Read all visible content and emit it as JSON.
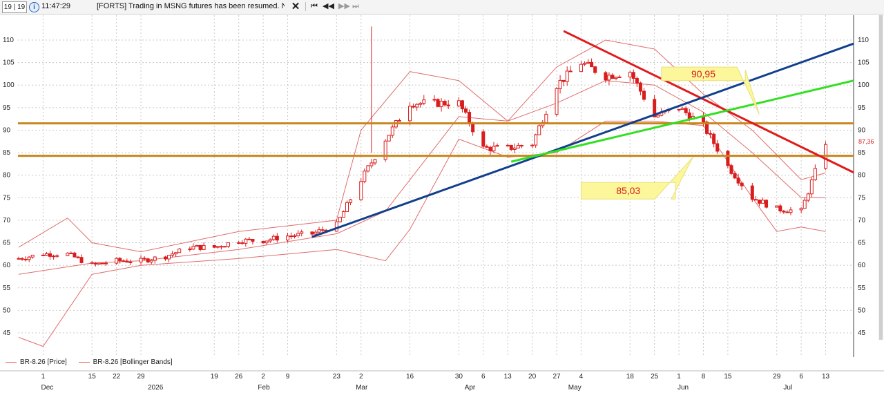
{
  "toolbar": {
    "counter": "19 | 19",
    "time": "11:47:29",
    "message": "[FORTS] Trading in MSNG futures has been resumed. New lower bounds o",
    "close_symbol": "✕",
    "nav_first": "⏮",
    "nav_prev": "◀◀",
    "nav_next": "▶▶",
    "nav_last": "⏭"
  },
  "legend": [
    {
      "label": "BR-8.26 [Price]"
    },
    {
      "label": "BR-8.26 [Bollinger Bands]"
    }
  ],
  "colors": {
    "candle": "#d91c1c",
    "band": "#e06b6b",
    "resistance": "#c9861a",
    "red_trend": "#e01b1b",
    "blue_trend": "#123f8c",
    "green_trend": "#33e020",
    "callout": "#fbf79a",
    "callout_text": "#d91c1c"
  },
  "chart_data": {
    "type": "candlestick",
    "y_axis": {
      "min": 40,
      "max": 112,
      "ticks": [
        45,
        50,
        55,
        60,
        65,
        70,
        75,
        80,
        85,
        90,
        95,
        100,
        105,
        110
      ]
    },
    "last_price_label": "87,36",
    "x_ticks": [
      {
        "label": "1",
        "x": "2025-12-01"
      },
      {
        "label": "15",
        "x": "2025-12-15"
      },
      {
        "label": "22",
        "x": "2025-12-22"
      },
      {
        "label": "29",
        "x": "2025-12-29"
      },
      {
        "label": "19",
        "x": "2026-01-19"
      },
      {
        "label": "26",
        "x": "2026-01-26"
      },
      {
        "label": "2",
        "x": "2026-02-02"
      },
      {
        "label": "9",
        "x": "2026-02-09"
      },
      {
        "label": "23",
        "x": "2026-02-23"
      },
      {
        "label": "2",
        "x": "2026-03-02"
      },
      {
        "label": "16",
        "x": "2026-03-16"
      },
      {
        "label": "30",
        "x": "2026-03-30"
      },
      {
        "label": "6",
        "x": "2026-04-06"
      },
      {
        "label": "13",
        "x": "2026-04-13"
      },
      {
        "label": "20",
        "x": "2026-04-20"
      },
      {
        "label": "27",
        "x": "2026-04-27"
      },
      {
        "label": "4",
        "x": "2026-05-04"
      },
      {
        "label": "18",
        "x": "2026-05-18"
      },
      {
        "label": "25",
        "x": "2026-05-25"
      },
      {
        "label": "1",
        "x": "2026-06-01"
      },
      {
        "label": "8",
        "x": "2026-06-08"
      },
      {
        "label": "15",
        "x": "2026-06-15"
      },
      {
        "label": "29",
        "x": "2026-06-29"
      },
      {
        "label": "6",
        "x": "2026-07-06"
      },
      {
        "label": "13",
        "x": "2026-07-13"
      }
    ],
    "months": [
      {
        "label": "Dec",
        "x": "2025-12-01"
      },
      {
        "label": "2026",
        "x": "2026-01-01"
      },
      {
        "label": "Feb",
        "x": "2026-02-01"
      },
      {
        "label": "Mar",
        "x": "2026-03-01"
      },
      {
        "label": "Apr",
        "x": "2026-04-01"
      },
      {
        "label": "May",
        "x": "2026-05-01"
      },
      {
        "label": "Jun",
        "x": "2026-06-01"
      },
      {
        "label": "Jul",
        "x": "2026-07-01"
      }
    ],
    "price_path": [
      [
        "2025-11-24",
        61.5
      ],
      [
        "2025-12-01",
        62.5
      ],
      [
        "2025-12-08",
        62.5
      ],
      [
        "2025-12-15",
        60.0
      ],
      [
        "2025-12-22",
        61.0
      ],
      [
        "2025-12-29",
        61.0
      ],
      [
        "2026-01-05",
        62.0
      ],
      [
        "2026-01-12",
        64.0
      ],
      [
        "2026-01-19",
        64.0
      ],
      [
        "2026-01-26",
        65.5
      ],
      [
        "2026-02-02",
        65.5
      ],
      [
        "2026-02-09",
        66.5
      ],
      [
        "2026-02-16",
        67.0
      ],
      [
        "2026-02-23",
        69.0
      ],
      [
        "2026-03-02",
        79.0
      ],
      [
        "2026-03-09",
        88.0
      ],
      [
        "2026-03-16",
        96.0
      ],
      [
        "2026-03-23",
        96.0
      ],
      [
        "2026-03-30",
        96.0
      ],
      [
        "2026-04-06",
        86.0
      ],
      [
        "2026-04-13",
        86.0
      ],
      [
        "2026-04-20",
        87.0
      ],
      [
        "2026-04-27",
        100.0
      ],
      [
        "2026-05-04",
        105.0
      ],
      [
        "2026-05-11",
        102.0
      ],
      [
        "2026-05-18",
        103.0
      ],
      [
        "2026-05-25",
        93.0
      ],
      [
        "2026-06-01",
        95.0
      ],
      [
        "2026-06-08",
        91.0
      ],
      [
        "2026-06-15",
        82.0
      ],
      [
        "2026-06-22",
        75.0
      ],
      [
        "2026-06-29",
        72.5
      ],
      [
        "2026-07-06",
        72.0
      ],
      [
        "2026-07-13",
        87.36
      ]
    ],
    "bollinger_upper": [
      [
        "2025-11-24",
        64.0
      ],
      [
        "2025-12-08",
        70.5
      ],
      [
        "2025-12-15",
        65.0
      ],
      [
        "2025-12-29",
        63.0
      ],
      [
        "2026-01-26",
        67.5
      ],
      [
        "2026-02-23",
        70.0
      ],
      [
        "2026-03-02",
        90.0
      ],
      [
        "2026-03-16",
        103.0
      ],
      [
        "2026-03-30",
        101.0
      ],
      [
        "2026-04-13",
        92.0
      ],
      [
        "2026-04-27",
        104.0
      ],
      [
        "2026-05-11",
        110.0
      ],
      [
        "2026-05-25",
        108.0
      ],
      [
        "2026-06-08",
        98.0
      ],
      [
        "2026-06-22",
        90.0
      ],
      [
        "2026-07-06",
        79.0
      ],
      [
        "2026-07-13",
        80.5
      ]
    ],
    "bollinger_middle": [
      [
        "2025-11-24",
        58.0
      ],
      [
        "2025-12-15",
        60.5
      ],
      [
        "2025-12-29",
        61.0
      ],
      [
        "2026-01-26",
        63.5
      ],
      [
        "2026-02-23",
        67.0
      ],
      [
        "2026-03-09",
        72.0
      ],
      [
        "2026-03-30",
        93.0
      ],
      [
        "2026-04-13",
        92.0
      ],
      [
        "2026-04-27",
        96.0
      ],
      [
        "2026-05-11",
        101.0
      ],
      [
        "2026-05-25",
        100.0
      ],
      [
        "2026-06-08",
        94.0
      ],
      [
        "2026-06-22",
        85.0
      ],
      [
        "2026-07-06",
        75.0
      ],
      [
        "2026-07-13",
        75.0
      ]
    ],
    "bollinger_lower": [
      [
        "2025-11-24",
        44.0
      ],
      [
        "2025-12-01",
        42.0
      ],
      [
        "2025-12-15",
        58.0
      ],
      [
        "2025-12-29",
        60.0
      ],
      [
        "2026-01-26",
        61.5
      ],
      [
        "2026-02-23",
        63.5
      ],
      [
        "2026-03-09",
        61.0
      ],
      [
        "2026-03-16",
        68.0
      ],
      [
        "2026-03-30",
        88.0
      ],
      [
        "2026-04-13",
        84.0
      ],
      [
        "2026-04-27",
        85.0
      ],
      [
        "2026-05-11",
        92.0
      ],
      [
        "2026-05-25",
        92.0
      ],
      [
        "2026-06-08",
        91.0
      ],
      [
        "2026-06-22",
        75.0
      ],
      [
        "2026-06-29",
        67.5
      ],
      [
        "2026-07-06",
        68.5
      ],
      [
        "2026-07-13",
        67.5
      ]
    ],
    "horizontal_levels": [
      {
        "value": 91.5
      },
      {
        "value": 84.3
      }
    ],
    "trend_lines": [
      {
        "color_key": "red_trend",
        "from": [
          "2026-04-29",
          112.0
        ],
        "to": [
          "2026-07-21",
          80.6
        ]
      },
      {
        "color_key": "blue_trend",
        "from": [
          "2026-02-16",
          66.3
        ],
        "to": [
          "2026-07-21",
          109.2
        ]
      },
      {
        "color_key": "green_trend",
        "from": [
          "2026-04-14",
          83.0
        ],
        "to": [
          "2026-07-21",
          101.0
        ]
      }
    ],
    "callouts": [
      {
        "text": "90,95",
        "box": {
          "x": [
            "2026-05-27",
            "2026-06-20"
          ],
          "y": [
            101.0,
            104.0
          ]
        },
        "tip": [
          "2026-06-24",
          93.5
        ]
      },
      {
        "text": "85,03",
        "box": {
          "x": [
            "2026-05-04",
            "2026-05-31"
          ],
          "y": [
            74.7,
            78.4
          ]
        },
        "tip": [
          "2026-06-05",
          84.0
        ]
      }
    ]
  }
}
